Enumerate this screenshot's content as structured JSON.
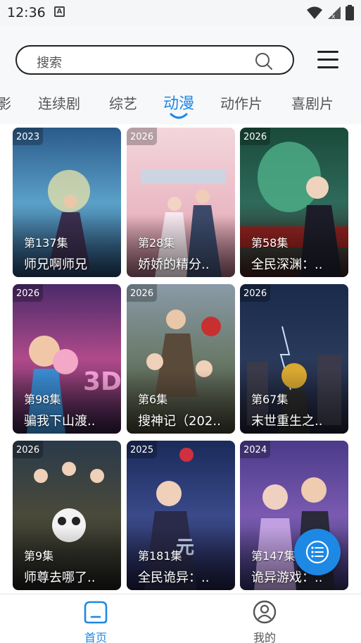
{
  "status_bar": {
    "time": "12:36",
    "notification_glyph": "A"
  },
  "search": {
    "placeholder": "搜索"
  },
  "tabs": [
    {
      "label": "影"
    },
    {
      "label": "连续剧"
    },
    {
      "label": "综艺"
    },
    {
      "label": "动漫",
      "active": true
    },
    {
      "label": "动作片"
    },
    {
      "label": "喜剧片"
    }
  ],
  "cards": [
    {
      "year": "2023",
      "episodes": "第137集",
      "title": "师兄啊师兄"
    },
    {
      "year": "2026",
      "episodes": "第28集",
      "title": "娇娇的精分.."
    },
    {
      "year": "2026",
      "episodes": "第58集",
      "title": "全民深渊：.."
    },
    {
      "year": "2026",
      "episodes": "第98集",
      "title": "骗我下山渡.."
    },
    {
      "year": "2026",
      "episodes": "第6集",
      "title": "搜神记（202.."
    },
    {
      "year": "2026",
      "episodes": "第67集",
      "title": "末世重生之.."
    },
    {
      "year": "2026",
      "episodes": "第9集",
      "title": "师尊去哪了.."
    },
    {
      "year": "2025",
      "episodes": "第181集",
      "title": "全民诡异：.."
    },
    {
      "year": "2024",
      "episodes": "第147集",
      "title": "诡异游戏：.."
    }
  ],
  "bottom_nav": {
    "home_label": "首页",
    "mine_label": "我的"
  },
  "colors": {
    "accent": "#1e88e5"
  }
}
